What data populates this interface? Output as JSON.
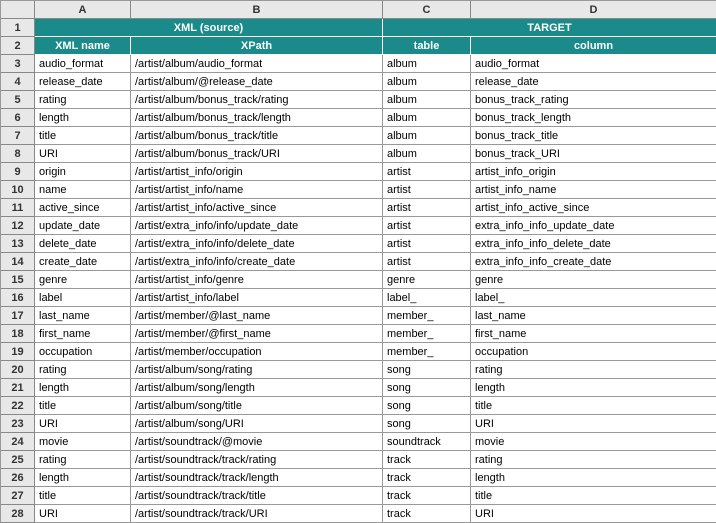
{
  "cols": [
    "A",
    "B",
    "C",
    "D"
  ],
  "merged_header": {
    "xml_source": "XML (source)",
    "target": "TARGET"
  },
  "subheader": {
    "xml_name": "XML name",
    "xpath": "XPath",
    "table": "table",
    "column": "column"
  },
  "rows": [
    {
      "n": 3,
      "a": "audio_format",
      "b": "/artist/album/audio_format",
      "c": "album",
      "d": "audio_format"
    },
    {
      "n": 4,
      "a": "release_date",
      "b": "/artist/album/@release_date",
      "c": "album",
      "d": "release_date"
    },
    {
      "n": 5,
      "a": "rating",
      "b": "/artist/album/bonus_track/rating",
      "c": "album",
      "d": "bonus_track_rating"
    },
    {
      "n": 6,
      "a": "length",
      "b": "/artist/album/bonus_track/length",
      "c": "album",
      "d": "bonus_track_length"
    },
    {
      "n": 7,
      "a": "title",
      "b": "/artist/album/bonus_track/title",
      "c": "album",
      "d": "bonus_track_title"
    },
    {
      "n": 8,
      "a": "URI",
      "b": "/artist/album/bonus_track/URI",
      "c": "album",
      "d": "bonus_track_URI"
    },
    {
      "n": 9,
      "a": "origin",
      "b": "/artist/artist_info/origin",
      "c": "artist",
      "d": "artist_info_origin"
    },
    {
      "n": 10,
      "a": "name",
      "b": "/artist/artist_info/name",
      "c": "artist",
      "d": "artist_info_name"
    },
    {
      "n": 11,
      "a": "active_since",
      "b": "/artist/artist_info/active_since",
      "c": "artist",
      "d": "artist_info_active_since"
    },
    {
      "n": 12,
      "a": "update_date",
      "b": "/artist/extra_info/info/update_date",
      "c": "artist",
      "d": "extra_info_info_update_date"
    },
    {
      "n": 13,
      "a": "delete_date",
      "b": "/artist/extra_info/info/delete_date",
      "c": "artist",
      "d": "extra_info_info_delete_date"
    },
    {
      "n": 14,
      "a": "create_date",
      "b": "/artist/extra_info/info/create_date",
      "c": "artist",
      "d": "extra_info_info_create_date"
    },
    {
      "n": 15,
      "a": "genre",
      "b": "/artist/artist_info/genre",
      "c": "genre",
      "d": "genre"
    },
    {
      "n": 16,
      "a": "label",
      "b": "/artist/artist_info/label",
      "c": "label_",
      "d": "label_"
    },
    {
      "n": 17,
      "a": "last_name",
      "b": "/artist/member/@last_name",
      "c": "member_",
      "d": "last_name"
    },
    {
      "n": 18,
      "a": "first_name",
      "b": "/artist/member/@first_name",
      "c": "member_",
      "d": "first_name"
    },
    {
      "n": 19,
      "a": "occupation",
      "b": "/artist/member/occupation",
      "c": "member_",
      "d": "occupation"
    },
    {
      "n": 20,
      "a": "rating",
      "b": "/artist/album/song/rating",
      "c": "song",
      "d": "rating"
    },
    {
      "n": 21,
      "a": "length",
      "b": "/artist/album/song/length",
      "c": "song",
      "d": "length"
    },
    {
      "n": 22,
      "a": "title",
      "b": "/artist/album/song/title",
      "c": "song",
      "d": "title"
    },
    {
      "n": 23,
      "a": "URI",
      "b": "/artist/album/song/URI",
      "c": "song",
      "d": "URI"
    },
    {
      "n": 24,
      "a": "movie",
      "b": "/artist/soundtrack/@movie",
      "c": "soundtrack",
      "d": "movie"
    },
    {
      "n": 25,
      "a": "rating",
      "b": "/artist/soundtrack/track/rating",
      "c": "track",
      "d": "rating"
    },
    {
      "n": 26,
      "a": "length",
      "b": "/artist/soundtrack/track/length",
      "c": "track",
      "d": "length"
    },
    {
      "n": 27,
      "a": "title",
      "b": "/artist/soundtrack/track/title",
      "c": "track",
      "d": "title"
    },
    {
      "n": 28,
      "a": "URI",
      "b": "/artist/soundtrack/track/URI",
      "c": "track",
      "d": "URI"
    }
  ]
}
